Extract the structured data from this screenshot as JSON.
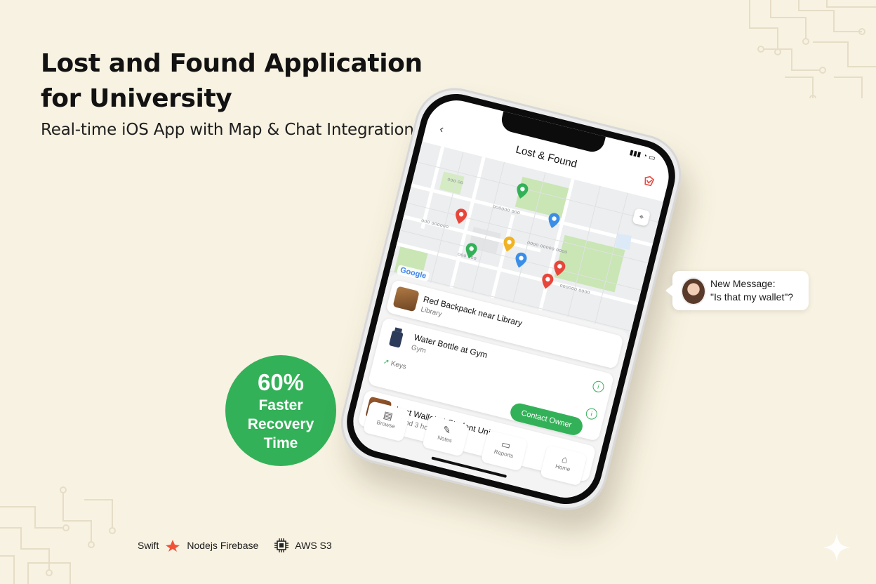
{
  "hero": {
    "title_line1": "Lost and Found Application",
    "title_line2": "for University",
    "subtitle": "Real-time iOS App with Map & Chat Integration"
  },
  "stat": {
    "value": "60%",
    "label": "Faster Recovery Time",
    "color": "#33b158"
  },
  "tech_stack": {
    "swift": "Swift",
    "nodejs_firebase": "Nodejs Firebase",
    "aws": "AWS S3"
  },
  "phone": {
    "app_title": "Lost & Found",
    "back_icon": "back-chevron-icon",
    "map": {
      "provider_label": "Google",
      "pins": [
        {
          "color": "#e8463b"
        },
        {
          "color": "#33b158"
        },
        {
          "color": "#33b158"
        },
        {
          "color": "#3b8ee8"
        },
        {
          "color": "#f0b323"
        },
        {
          "color": "#3b8ee8"
        },
        {
          "color": "#e8463b"
        },
        {
          "color": "#e8463b"
        }
      ]
    },
    "items": [
      {
        "title": "Red Backpack near Library",
        "subtitle": "Library"
      },
      {
        "title": "Water Bottle at Gym",
        "subtitle": "Gym"
      },
      {
        "title": "Lost Wallet at Student Union",
        "subtitle": "Found 3 hours ago"
      }
    ],
    "chip_label": "Keys",
    "contact_button": "Contact Owner",
    "tabs": [
      {
        "label": "Browse",
        "icon": "map-icon"
      },
      {
        "label": "Notes",
        "icon": "note-icon"
      },
      {
        "label": "Reports",
        "icon": "chat-icon"
      },
      {
        "label": "Home",
        "icon": "home-icon"
      }
    ]
  },
  "notification": {
    "title": "New Message:",
    "message": "\"Is that my wallet\"?"
  },
  "colors": {
    "background": "#f8f2e2",
    "accent": "#33b158",
    "text": "#121212"
  }
}
